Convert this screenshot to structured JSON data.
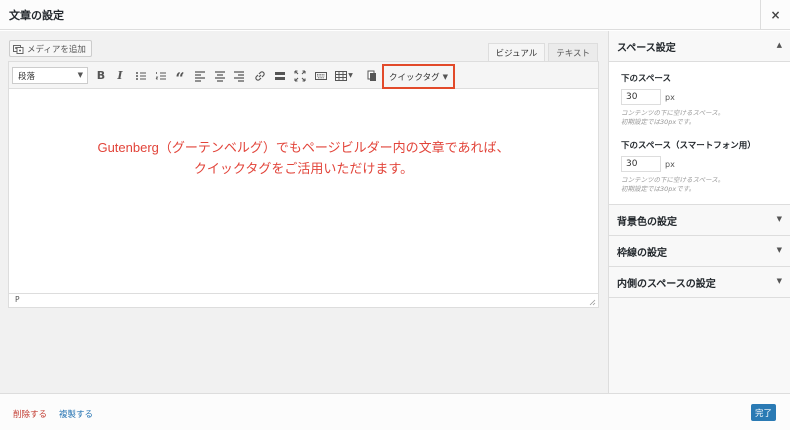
{
  "header": {
    "title": "文章の設定",
    "close_glyph": "×"
  },
  "editor": {
    "add_media_label": "メディアを追加",
    "tabs": [
      {
        "label": "ビジュアル",
        "active": true
      },
      {
        "label": "テキスト",
        "active": false
      }
    ],
    "format_select": "段落",
    "quicktag_label": "クイックタグ",
    "bold_glyph": "B",
    "italic_glyph": "I",
    "quote_glyph": "“",
    "content_lines": [
      "Gutenberg（グーテンベルグ）でもページビルダー内の文章であれば、",
      "クイックタグをご活用いただけます。"
    ],
    "status_path": "P"
  },
  "panel": {
    "space_section": {
      "title": "スペース設定",
      "expanded": true,
      "fields": [
        {
          "label": "下のスペース",
          "value": "30",
          "unit": "px",
          "desc_line1": "コンテンツの下に空けるスペース。",
          "desc_line2": "初期設定では30pxです。"
        },
        {
          "label": "下のスペース（スマートフォン用）",
          "value": "30",
          "unit": "px",
          "desc_line1": "コンテンツの下に空けるスペース。",
          "desc_line2": "初期設定では30pxです。"
        }
      ]
    },
    "collapsed_sections": [
      {
        "title": "背景色の設定"
      },
      {
        "title": "枠線の設定"
      },
      {
        "title": "内側のスペースの設定"
      }
    ]
  },
  "footer": {
    "delete_label": "削除する",
    "duplicate_label": "複製する",
    "done_label": "完了"
  },
  "colors": {
    "accent_red": "#e24a2a",
    "primary_blue": "#2a7ab4",
    "delete_red": "#c23a2f"
  }
}
